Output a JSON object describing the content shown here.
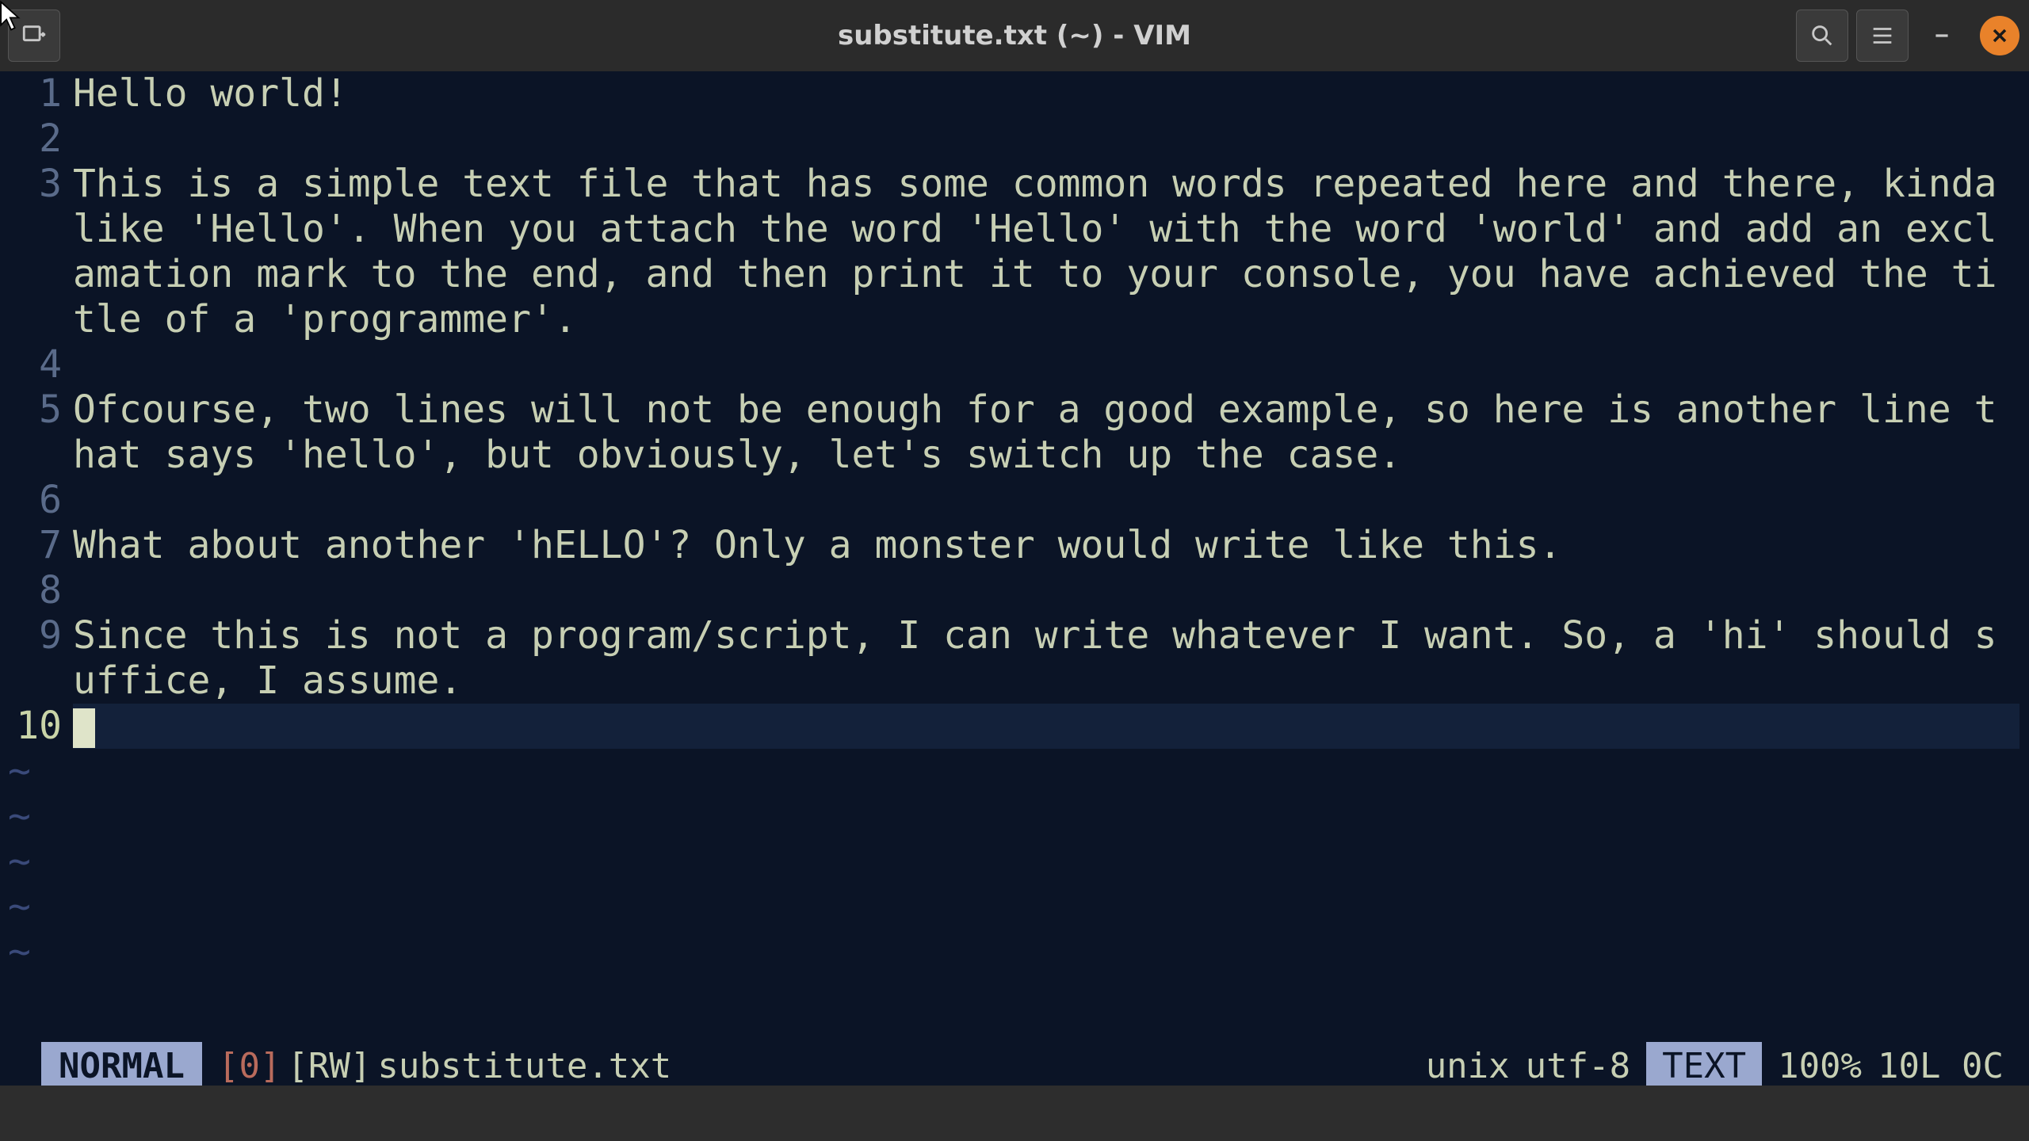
{
  "titlebar": {
    "title": "substitute.txt (~) - VIM"
  },
  "editor": {
    "cursor_line": 10,
    "total_lines": 10,
    "lines": [
      {
        "n": 1,
        "text": "Hello world!"
      },
      {
        "n": 2,
        "text": ""
      },
      {
        "n": 3,
        "text": "This is a simple text file that has some common words repeated here and there, kinda like 'Hello'. When you attach the word 'Hello' with the word 'world' and add an exclamation mark to the end, and then print it to your console, you have achieved the title of a 'programmer'."
      },
      {
        "n": 4,
        "text": ""
      },
      {
        "n": 5,
        "text": "Ofcourse, two lines will not be enough for a good example, so here is another line that says 'hello', but obviously, let's switch up the case."
      },
      {
        "n": 6,
        "text": ""
      },
      {
        "n": 7,
        "text": "What about another 'hELLO'? Only a monster would write like this."
      },
      {
        "n": 8,
        "text": ""
      },
      {
        "n": 9,
        "text": "Since this is not a program/script, I can write whatever I want. So, a 'hi' should suffice, I assume."
      },
      {
        "n": 10,
        "text": ""
      }
    ],
    "tilde_rows": 5
  },
  "status": {
    "mode": "NORMAL",
    "buffer": "[0]",
    "rw": "[RW]",
    "filename": "substitute.txt",
    "fileformat": "unix",
    "encoding": "utf-8",
    "filetype": "TEXT",
    "percent": "100%",
    "linecol": "10L 0C"
  }
}
